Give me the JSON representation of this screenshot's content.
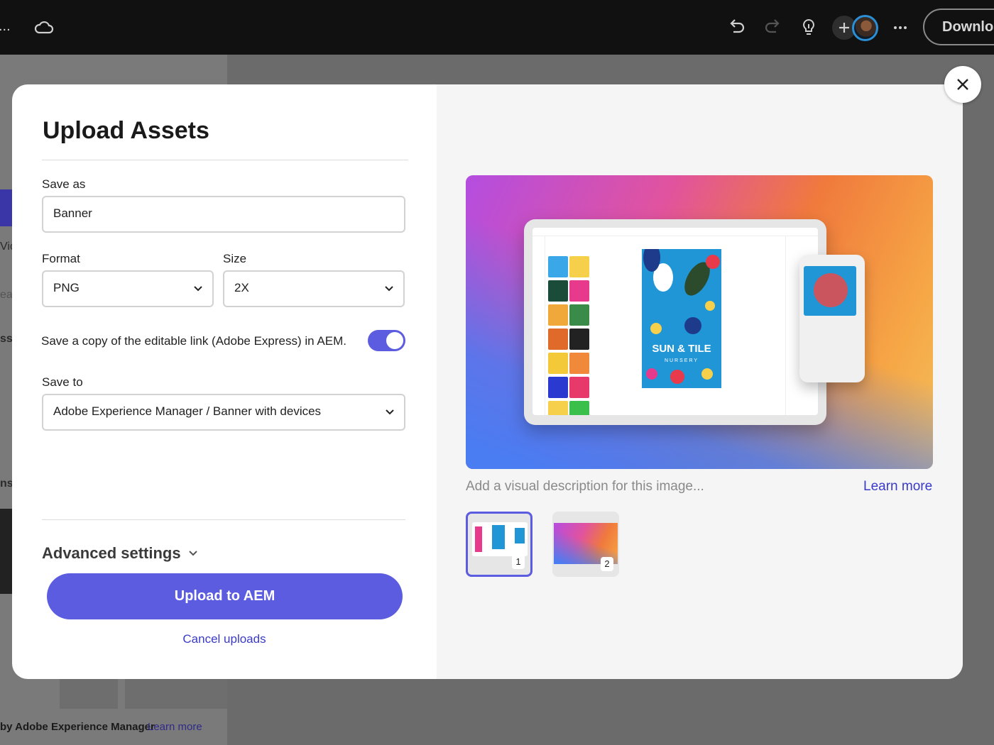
{
  "topbar": {
    "project_label": "...",
    "download_label": "Downloa",
    "icons": [
      "cloud-icon",
      "undo-icon",
      "redo-icon",
      "lightbulb-icon",
      "add-icon",
      "avatar",
      "more-icon"
    ]
  },
  "background": {
    "fragments": [
      "Vic",
      "ear",
      "sse",
      "ns"
    ],
    "footer_text": "by Adobe Experience Manager",
    "footer_link": "Learn more"
  },
  "modal": {
    "title": "Upload Assets",
    "save_as": {
      "label": "Save as",
      "value": "Banner"
    },
    "format": {
      "label": "Format",
      "value": "PNG"
    },
    "size": {
      "label": "Size",
      "value": "2X"
    },
    "editable_link": {
      "label": "Save a copy of the editable link (Adobe Express) in AEM.",
      "checked": true
    },
    "save_to": {
      "label": "Save to",
      "value": "Adobe Experience Manager / Banner with devices"
    },
    "advanced_label": "Advanced settings",
    "upload_button": "Upload to AEM",
    "cancel_link": "Cancel uploads",
    "preview": {
      "poster_title": "SUN & TILE",
      "poster_subtitle": "NURSERY",
      "description_placeholder": "Add a visual description for this image...",
      "learn_more": "Learn more",
      "thumbnails": [
        {
          "number": "1",
          "selected": true
        },
        {
          "number": "2",
          "selected": false
        }
      ]
    }
  },
  "colors": {
    "accent": "#5c5ce0",
    "link": "#3a3ac8",
    "topbar": "#111111"
  }
}
